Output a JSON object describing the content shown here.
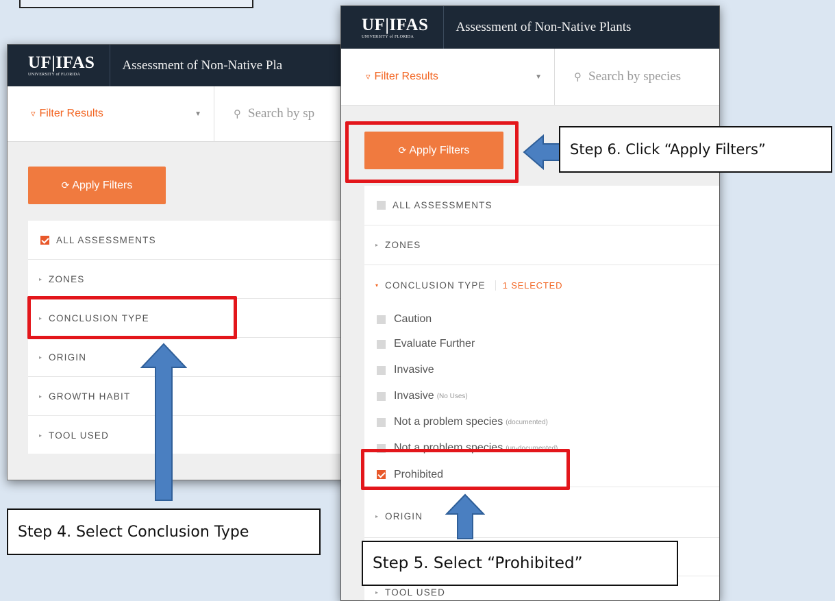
{
  "logo": {
    "main": "UF|IFAS",
    "sub": "UNIVERSITY of FLORIDA"
  },
  "app_title": "Assessment of Non-Native Plants",
  "panel1": {
    "header_title": "Assessment of Non-Native Pla",
    "filter_label": "Filter Results",
    "search_placeholder": "Search by sp",
    "apply_label": "Apply Filters",
    "rows": [
      "ALL ASSESSMENTS",
      "ZONES",
      "CONCLUSION TYPE",
      "ORIGIN",
      "GROWTH HABIT",
      "TOOL USED"
    ]
  },
  "panel2": {
    "header_title": "Assessment of Non-Native Plants",
    "filter_label": "Filter Results",
    "search_placeholder": "Search by species",
    "apply_label": "Apply Filters",
    "all_assessments": "ALL ASSESSMENTS",
    "zones": "ZONES",
    "conclusion_type": "CONCLUSION TYPE",
    "selected_badge": "1 SELECTED",
    "options": [
      {
        "label": "Caution",
        "note": ""
      },
      {
        "label": "Evaluate Further",
        "note": ""
      },
      {
        "label": "Invasive",
        "note": ""
      },
      {
        "label": "Invasive",
        "note": "(No Uses)"
      },
      {
        "label": "Not a problem species",
        "note": "(documented)"
      },
      {
        "label": "Not a problem species",
        "note": "(un-documented)"
      },
      {
        "label": "Prohibited",
        "note": ""
      }
    ],
    "origin": "ORIGIN",
    "tool_used": "TOOL USED"
  },
  "callouts": {
    "step4": "Step 4. Select Conclusion Type",
    "step5": "Step 5. Select “Prohibited”",
    "step6": "Step 6. Click “Apply Filters”"
  },
  "colors": {
    "accent": "#f07a3f",
    "header": "#1c2836",
    "highlight": "#e3161b",
    "arrow": "#4a7fc1"
  }
}
